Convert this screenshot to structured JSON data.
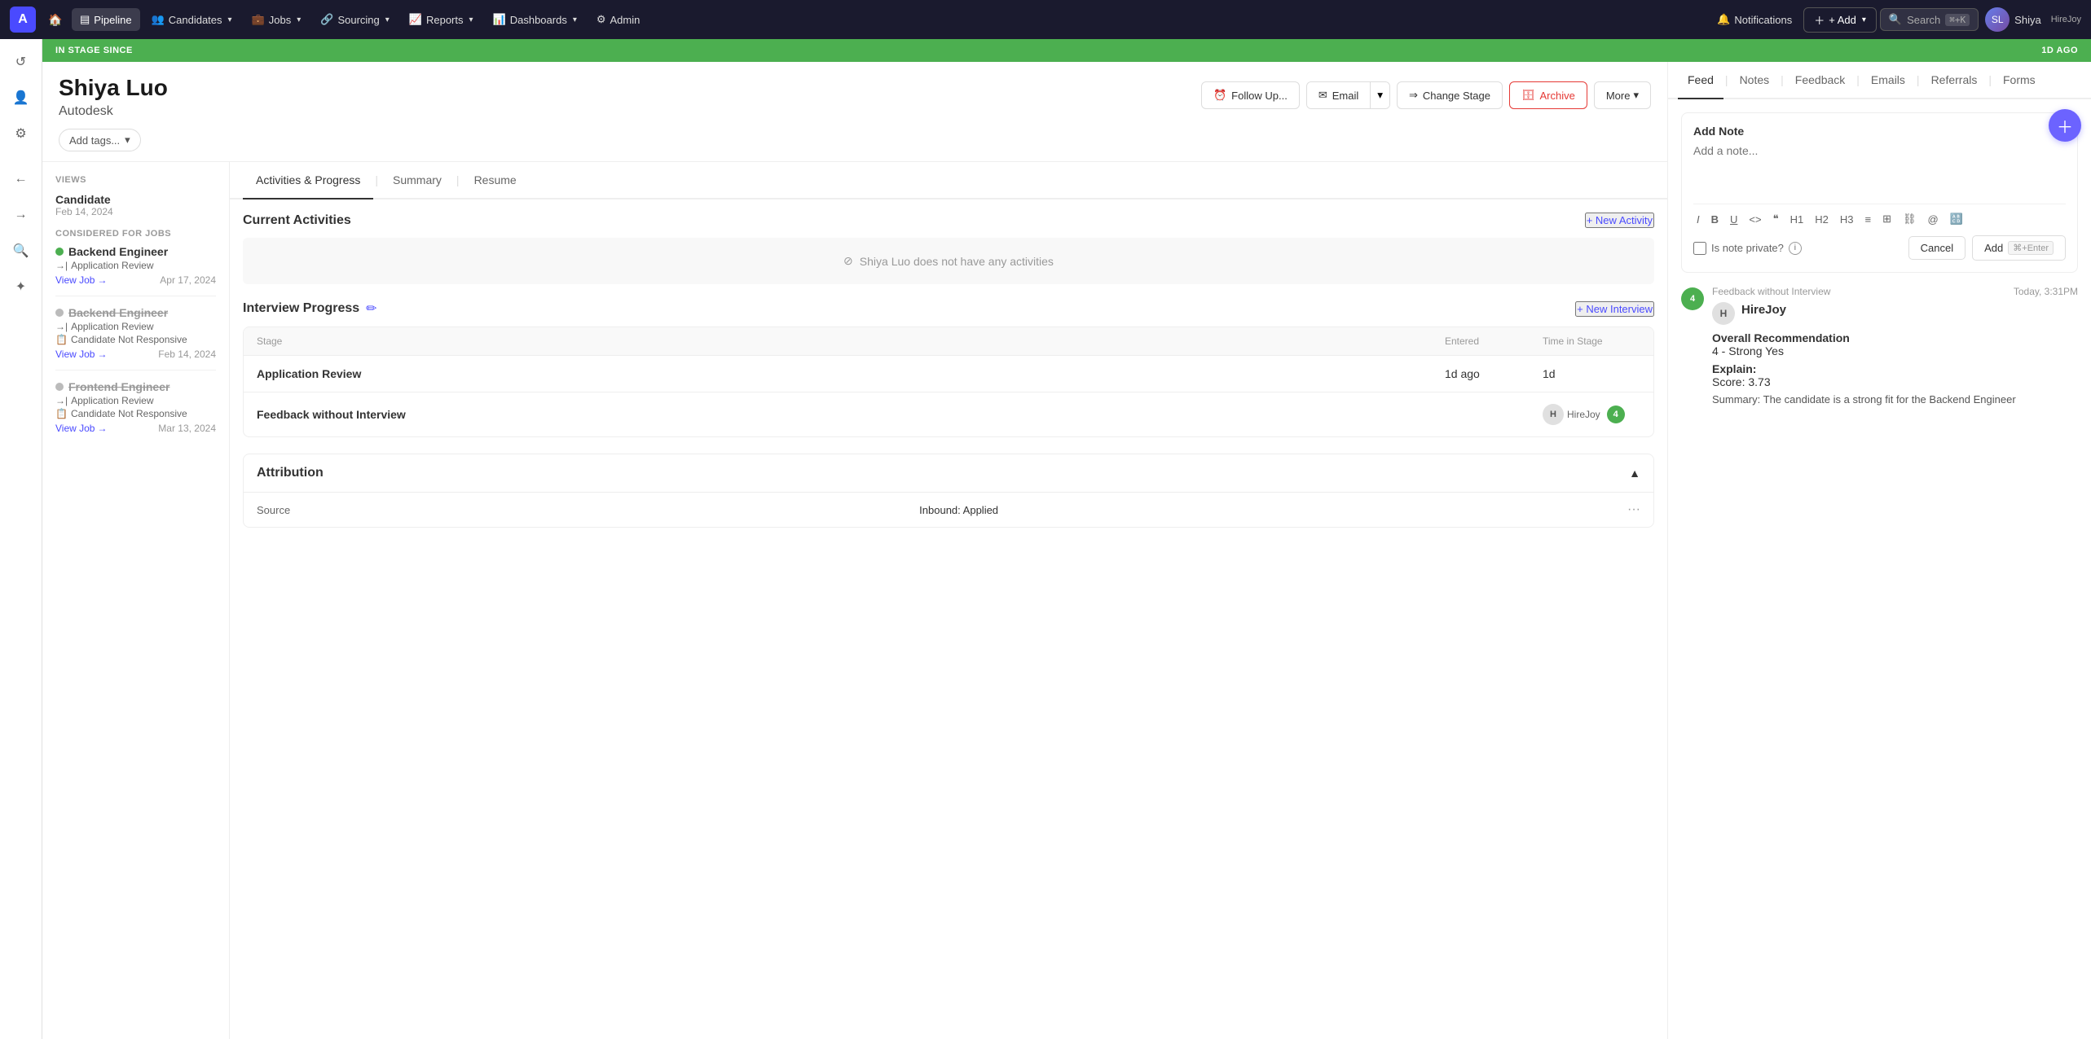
{
  "topNav": {
    "logo": "A",
    "items": [
      {
        "id": "pipeline",
        "label": "Pipeline",
        "active": true,
        "icon": "▤"
      },
      {
        "id": "candidates",
        "label": "Candidates",
        "hasDropdown": true,
        "icon": "👥"
      },
      {
        "id": "jobs",
        "label": "Jobs",
        "hasDropdown": true,
        "icon": "💼"
      },
      {
        "id": "sourcing",
        "label": "Sourcing",
        "hasDropdown": true,
        "icon": "🔗"
      },
      {
        "id": "reports",
        "label": "Reports",
        "hasDropdown": true,
        "icon": "📈"
      },
      {
        "id": "dashboards",
        "label": "Dashboards",
        "hasDropdown": true,
        "icon": "📊"
      },
      {
        "id": "admin",
        "label": "Admin",
        "icon": "⚙"
      }
    ],
    "notifications": "Notifications",
    "addBtn": "+ Add",
    "search": "Search",
    "searchShortcut": "⌘+K",
    "user": {
      "name": "Shiya",
      "company": "HireJoy"
    }
  },
  "stageBanner": {
    "left": "IN STAGE SINCE",
    "right": "1D AGO"
  },
  "candidate": {
    "name": "Shiya Luo",
    "company": "Autodesk",
    "tagsPlaceholder": "Add tags...",
    "actions": {
      "followUp": "Follow Up...",
      "email": "Email",
      "changeStage": "Change Stage",
      "archive": "Archive",
      "more": "More"
    }
  },
  "views": {
    "label": "VIEWS",
    "viewItem": {
      "name": "Candidate",
      "date": "Feb 14, 2024"
    },
    "consideredLabel": "CONSIDERED FOR JOBS",
    "jobs": [
      {
        "name": "Backend Engineer",
        "active": true,
        "stage": "Application Review",
        "link": "View Job",
        "date": "Apr 17, 2024"
      },
      {
        "name": "Backend Engineer",
        "active": false,
        "strikethrough": true,
        "stage": "Application Review",
        "rejection": "Candidate Not Responsive",
        "link": "View Job",
        "date": "Feb 14, 2024"
      },
      {
        "name": "Frontend Engineer",
        "active": false,
        "strikethrough": true,
        "stage": "Application Review",
        "rejection": "Candidate Not Responsive",
        "link": "View Job",
        "date": "Mar 13, 2024"
      }
    ]
  },
  "mainTabs": [
    "Activities & Progress",
    "Summary",
    "Resume"
  ],
  "activitiesSection": {
    "title": "Current Activities",
    "newActivityBtn": "+ New Activity",
    "emptyMessage": "Shiya Luo does not have any activities"
  },
  "interviewSection": {
    "title": "Interview Progress",
    "newInterviewBtn": "+ New Interview",
    "tableHeaders": [
      "Stage",
      "Entered",
      "Time in Stage"
    ],
    "rows": [
      {
        "stage": "Application Review",
        "entered": "1d ago",
        "timeInStage": "1d"
      },
      {
        "stage": "Feedback without Interview",
        "avatarLabel": "H",
        "avatarName": "HireJoy",
        "feedbackCount": "4"
      }
    ]
  },
  "attributionSection": {
    "title": "Attribution",
    "rows": [
      {
        "label": "Source",
        "value": "Inbound: Applied"
      }
    ]
  },
  "rightPanel": {
    "tabs": [
      "Feed",
      "Notes",
      "Feedback",
      "Emails",
      "Referrals",
      "Forms"
    ],
    "activeTab": "Feed",
    "addNote": {
      "title": "Add Note",
      "placeholder": "Add a note...",
      "toolbar": [
        "I",
        "B",
        "U",
        "<>",
        "❝",
        "H1",
        "H2",
        "H3",
        "≡",
        "⊞",
        "⛓",
        "@",
        "🔠"
      ],
      "isPrivateLabel": "Is note private?",
      "infoTooltip": "i",
      "cancelBtn": "Cancel",
      "addBtn": "Add",
      "addShortcut": "⌘+Enter"
    },
    "feedItem": {
      "badgeCount": "4",
      "type": "Feedback without Interview",
      "time": "Today, 3:31PM",
      "avatarLabel": "H",
      "authorName": "HireJoy",
      "overallRecommendationLabel": "Overall Recommendation",
      "overallRecommendationValue": "4 - Strong Yes",
      "explainLabel": "Explain:",
      "scoreValue": "Score: 3.73",
      "summaryLabel": "Summary:",
      "summaryText": "The candidate is a strong fit for the Backend Engineer"
    }
  }
}
